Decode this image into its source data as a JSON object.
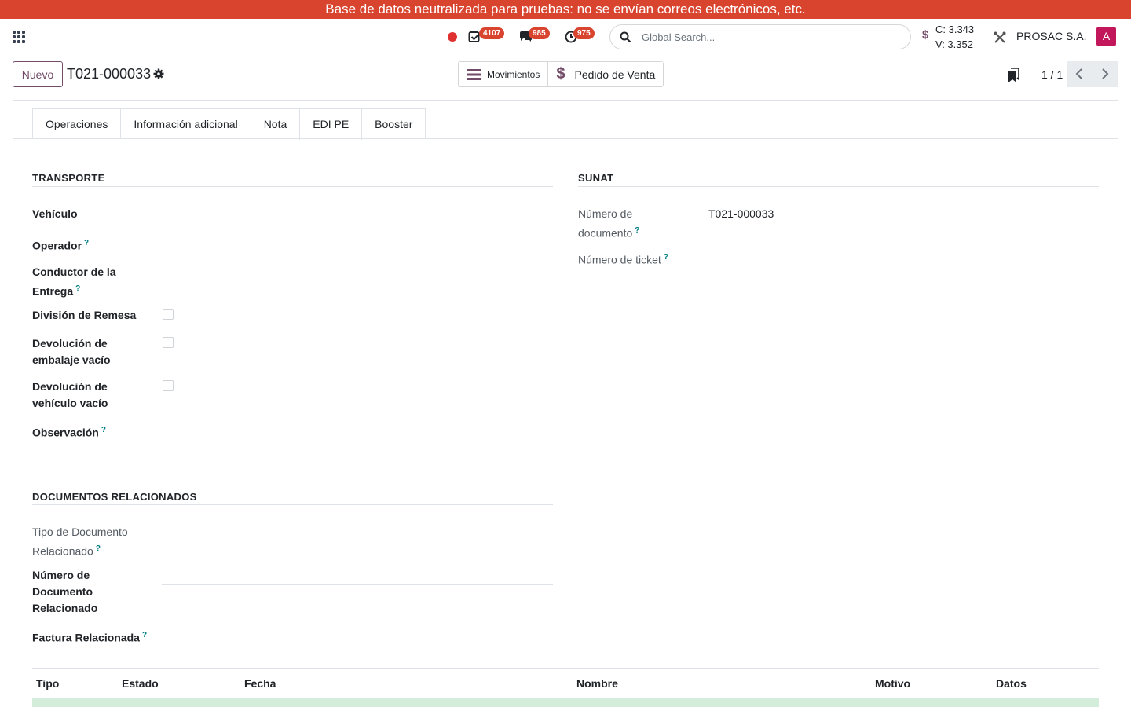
{
  "banner": {
    "text": "Base de datos neutralizada para pruebas: no se envían correos electrónicos, etc."
  },
  "navbar": {
    "badges": {
      "activities": "4107",
      "messages": "985",
      "timers": "975"
    },
    "search": {
      "placeholder": "Global Search..."
    },
    "rates": {
      "buy": "C: 3.343",
      "sell": "V: 3.352",
      "icon": "dollar-icon"
    },
    "company": "PROSAC S.A.",
    "avatar": "A"
  },
  "controls": {
    "new_label": "Nuevo",
    "record": "T021-000033",
    "smart_buttons": {
      "moves": "Movimientos",
      "sale_order": "Pedido de Venta"
    },
    "pager": "1 / 1"
  },
  "tabs": [
    "Operaciones",
    "Información adicional",
    "Nota",
    "EDI PE",
    "Booster"
  ],
  "active_tab": "EDI PE",
  "transporte": {
    "title": "TRANSPORTE",
    "vehiculo": "Vehículo",
    "operador": "Operador",
    "conductor": "Conductor de la Entrega",
    "division": "División de Remesa",
    "dev_embalaje": "Devolución de embalaje vacío",
    "dev_vehiculo": "Devolución de vehículo vacío",
    "observacion": "Observación"
  },
  "sunat": {
    "title": "SUNAT",
    "numero_documento": "Número de documento",
    "numero_documento_value": "T021-000033",
    "numero_ticket": "Número de ticket"
  },
  "relacionados": {
    "title": "DOCUMENTOS RELACIONADOS",
    "tipo": "Tipo de Documento Relacionado",
    "numero": "Número de Documento Relacionado",
    "factura": "Factura Relacionada"
  },
  "table": {
    "headers": [
      "Tipo",
      "Estado",
      "Fecha",
      "Nombre",
      "Motivo",
      "Datos"
    ]
  },
  "help_mark": "?",
  "colors": {
    "brand": "#714b67",
    "banner": "#d9442f",
    "help": "#017e84",
    "row_success": "#d4edda"
  }
}
